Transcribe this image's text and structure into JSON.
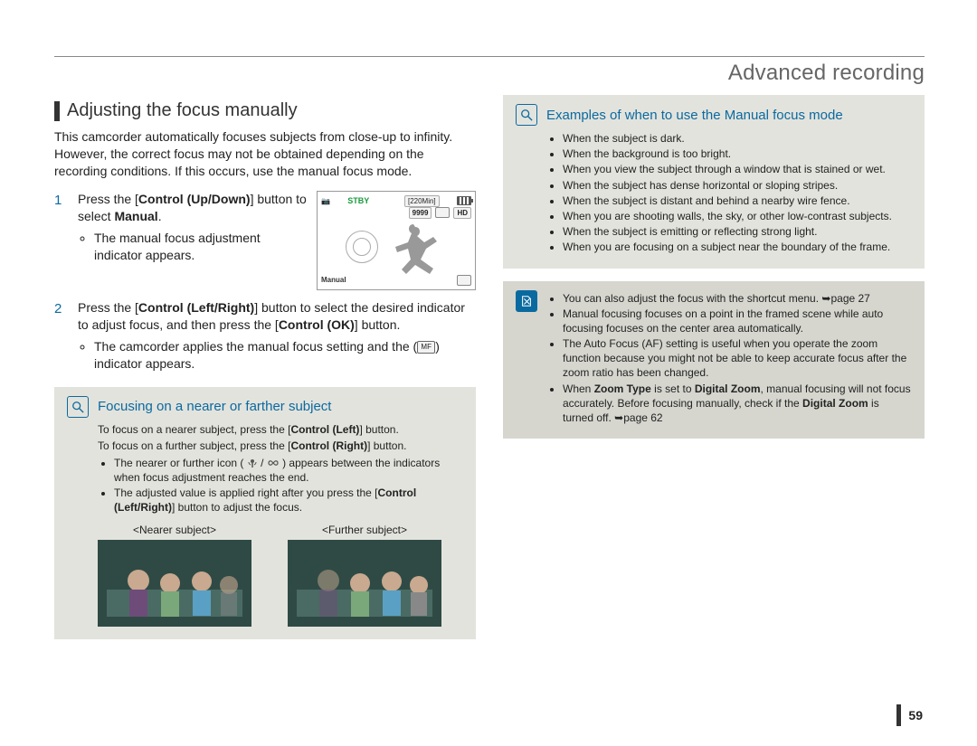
{
  "header": {
    "title": "Advanced recording"
  },
  "page_number": "59",
  "left": {
    "heading": "Adjusting the focus manually",
    "intro": "This camcorder automatically focuses subjects from close-up to infinity. However, the correct focus may not be obtained depending on the recording conditions. If this occurs, use the manual focus mode.",
    "steps": [
      {
        "n": "1",
        "line_a": "Press the [",
        "btn_a": "Control (Up/Down)",
        "line_b": "] button to select ",
        "bold_b": "Manual",
        "line_c": ".",
        "bullets": [
          "The manual focus adjustment indicator appears."
        ]
      },
      {
        "n": "2",
        "line_a": "Press the [",
        "btn_a": "Control (Left/Right)",
        "line_b": "] button to select the desired indicator to adjust focus, and then press the [",
        "btn_b": "Control (OK)",
        "line_c": "] button.",
        "bullets_prefix": "The camcorder applies the manual focus setting and the (",
        "bullets_suffix": ") indicator appears."
      }
    ],
    "lcd": {
      "stby": "STBY",
      "time": "[220Min]",
      "count": "9999",
      "label": "Manual",
      "hd": "HD"
    },
    "panel": {
      "title": "Focusing on a nearer or farther subject",
      "p1_a": "To focus on a nearer subject, press the [",
      "p1_b": "Control (Left)",
      "p1_c": "] button.",
      "p2_a": "To focus on a further subject, press the [",
      "p2_b": "Control (Right)",
      "p2_c": "] button.",
      "b1_a": "The nearer or further icon ( ",
      "b1_b": " / ",
      "b1_c": " ) appears between the indicators when focus adjustment reaches the end.",
      "b2_a": "The adjusted value is applied right after you press the [",
      "b2_b": "Control (Left/Right)",
      "b2_c": "] button to adjust the focus.",
      "cap_near": "<Nearer subject>",
      "cap_far": "<Further subject>"
    }
  },
  "right": {
    "panel1": {
      "title": "Examples of when to use the Manual focus mode",
      "items": [
        "When the subject is dark.",
        "When the background is too bright.",
        "When you view the subject through a window that is stained or wet.",
        "When the subject has dense horizontal or sloping stripes.",
        "When the subject is distant and behind a nearby wire fence.",
        "When you are shooting walls, the sky, or other low-contrast subjects.",
        "When the subject is emitting or reflecting strong light.",
        "When you are focusing on a subject near the boundary of the frame."
      ]
    },
    "panel2": {
      "b1_a": "You can also adjust the focus with the shortcut menu. ",
      "b1_b": "page 27",
      "b2": "Manual focusing focuses on a point in the framed scene while auto focusing focuses on the center area automatically.",
      "b3": "The Auto Focus (AF) setting is useful when you operate the zoom function because you might not be able to keep accurate focus after the zoom ratio has been changed.",
      "b4_a": "When ",
      "b4_b": "Zoom Type",
      "b4_c": " is set to ",
      "b4_d": "Digital Zoom",
      "b4_e": ", manual focusing will not focus accurately. Before focusing manually, check if the ",
      "b4_f": "Digital Zoom",
      "b4_g": " is turned off. ",
      "b4_h": "page 62"
    }
  }
}
